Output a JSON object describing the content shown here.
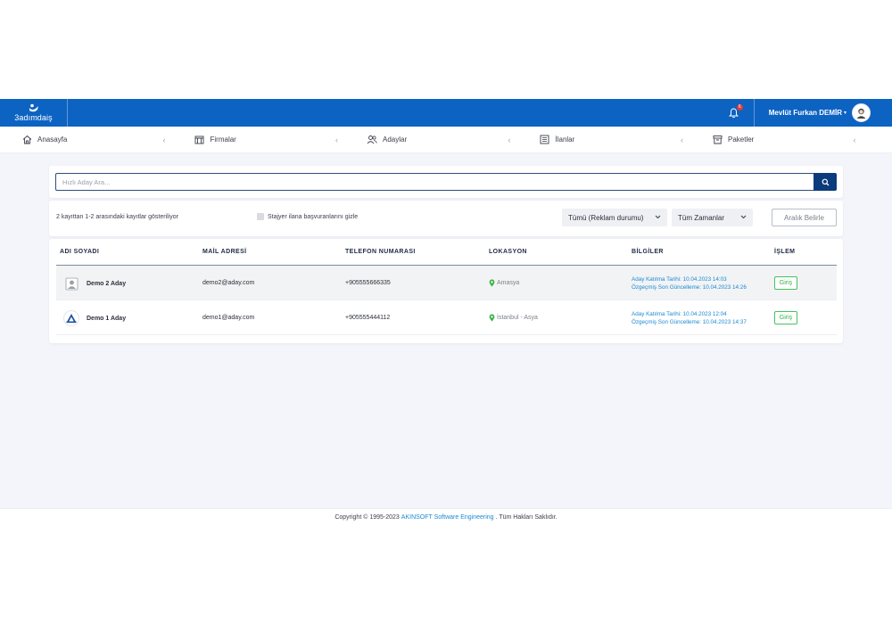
{
  "brand": {
    "name": "3adımdaiş"
  },
  "header": {
    "notification_count": "6",
    "user_name": "Mevlüt Furkan DEMİR",
    "caret": "▾"
  },
  "nav": {
    "items": [
      {
        "label": "Anasayfa",
        "icon": "home-icon"
      },
      {
        "label": "Firmalar",
        "icon": "building-icon"
      },
      {
        "label": "Adaylar",
        "icon": "users-icon"
      },
      {
        "label": "İlanlar",
        "icon": "list-icon"
      },
      {
        "label": "Paketler",
        "icon": "box-icon"
      }
    ],
    "chevron": "‹"
  },
  "search": {
    "placeholder": "Hızlı Aday Ara..."
  },
  "filters": {
    "info": "2 kayıttan 1-2 arasındaki kayıtlar gösteriliyor",
    "hide_interns_label": "Stajyer ilana başvuranlarını gizle",
    "ad_status": "Tümü (Reklam durumu)",
    "time": "Tüm Zamanlar",
    "range_button": "Aralık Belirle"
  },
  "table": {
    "columns": [
      "ADI SOYADI",
      "MAİL ADRESİ",
      "TELEFON NUMARASI",
      "LOKASYON",
      "BİLGİLER",
      "İŞLEM"
    ],
    "rows": [
      {
        "name": "Demo 2 Aday",
        "email": "demo2@aday.com",
        "phone": "+905555666335",
        "location": "Amasya",
        "info1": "Aday Katılma Tarihi: 10.04.2023 14:03",
        "info2": "Özgeçmiş Son Güncelleme: 10.04.2023 14:26",
        "action": "Giriş"
      },
      {
        "name": "Demo 1 Aday",
        "email": "demo1@aday.com",
        "phone": "+905555444112",
        "location": "İstanbul - Asya",
        "info1": "Aday Katılma Tarihi: 10.04.2023 12:04",
        "info2": "Özgeçmiş Son Güncelleme: 10.04.2023 14:37",
        "action": "Giriş"
      }
    ]
  },
  "footer": {
    "prefix": "Copyright © 1995-2023",
    "link": "AKINSOFT Software Engineering",
    "suffix": ". Tüm Hakları Saklıdır."
  },
  "colors": {
    "header_blue": "#0d63c2",
    "search_button": "#0b3b7a",
    "info_blue": "#1b8ad3",
    "action_green": "#37b14c",
    "location_green": "#3cb54a"
  }
}
